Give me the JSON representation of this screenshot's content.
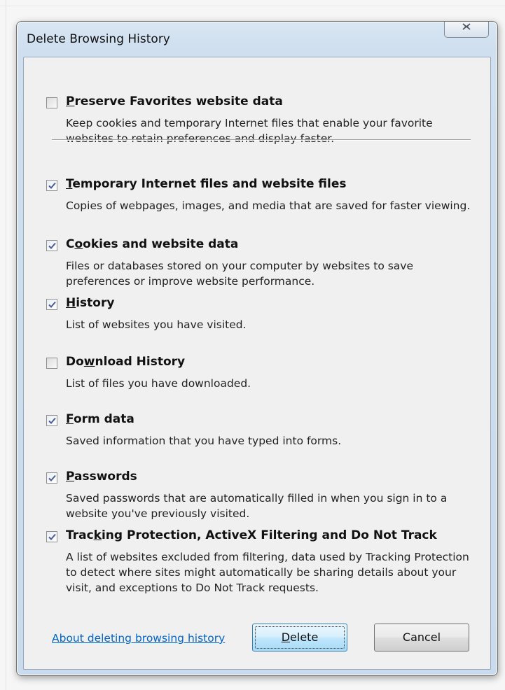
{
  "dialog": {
    "title": "Delete Browsing History",
    "close_icon": "close-icon"
  },
  "options": [
    {
      "key": "preserve_favorites",
      "title_pre": "",
      "title_accel": "P",
      "title_post": "reserve Favorites website data",
      "checked": false,
      "description": "Keep cookies and temporary Internet files that enable your favorite websites to retain preferences and display faster."
    },
    {
      "key": "temp_files",
      "title_pre": "",
      "title_accel": "T",
      "title_post": "emporary Internet files and website files",
      "checked": true,
      "description": "Copies of webpages, images, and media that are saved for faster viewing."
    },
    {
      "key": "cookies",
      "title_pre": "C",
      "title_accel": "o",
      "title_post": "okies and website data",
      "checked": true,
      "description": "Files or databases stored on your computer by websites to save preferences or improve website performance."
    },
    {
      "key": "history",
      "title_pre": "",
      "title_accel": "H",
      "title_post": "istory",
      "checked": true,
      "description": "List of websites you have visited."
    },
    {
      "key": "download_history",
      "title_pre": "Do",
      "title_accel": "w",
      "title_post": "nload History",
      "checked": false,
      "description": "List of files you have downloaded."
    },
    {
      "key": "form_data",
      "title_pre": "",
      "title_accel": "F",
      "title_post": "orm data",
      "checked": true,
      "description": "Saved information that you have typed into forms."
    },
    {
      "key": "passwords",
      "title_pre": "",
      "title_accel": "P",
      "title_post": "asswords",
      "checked": true,
      "description": "Saved passwords that are automatically filled in when you sign in to a website you've previously visited."
    },
    {
      "key": "tracking",
      "title_pre": "Trac",
      "title_accel": "k",
      "title_post": "ing Protection, ActiveX Filtering and Do Not Track",
      "checked": true,
      "description": "A list of websites excluded from filtering, data used by Tracking Protection to detect where sites might automatically be sharing details about your visit, and exceptions to Do Not Track requests."
    }
  ],
  "footer": {
    "about_link": "About deleting browsing history",
    "delete_pre": "",
    "delete_accel": "D",
    "delete_post": "elete",
    "cancel_label": "Cancel"
  }
}
